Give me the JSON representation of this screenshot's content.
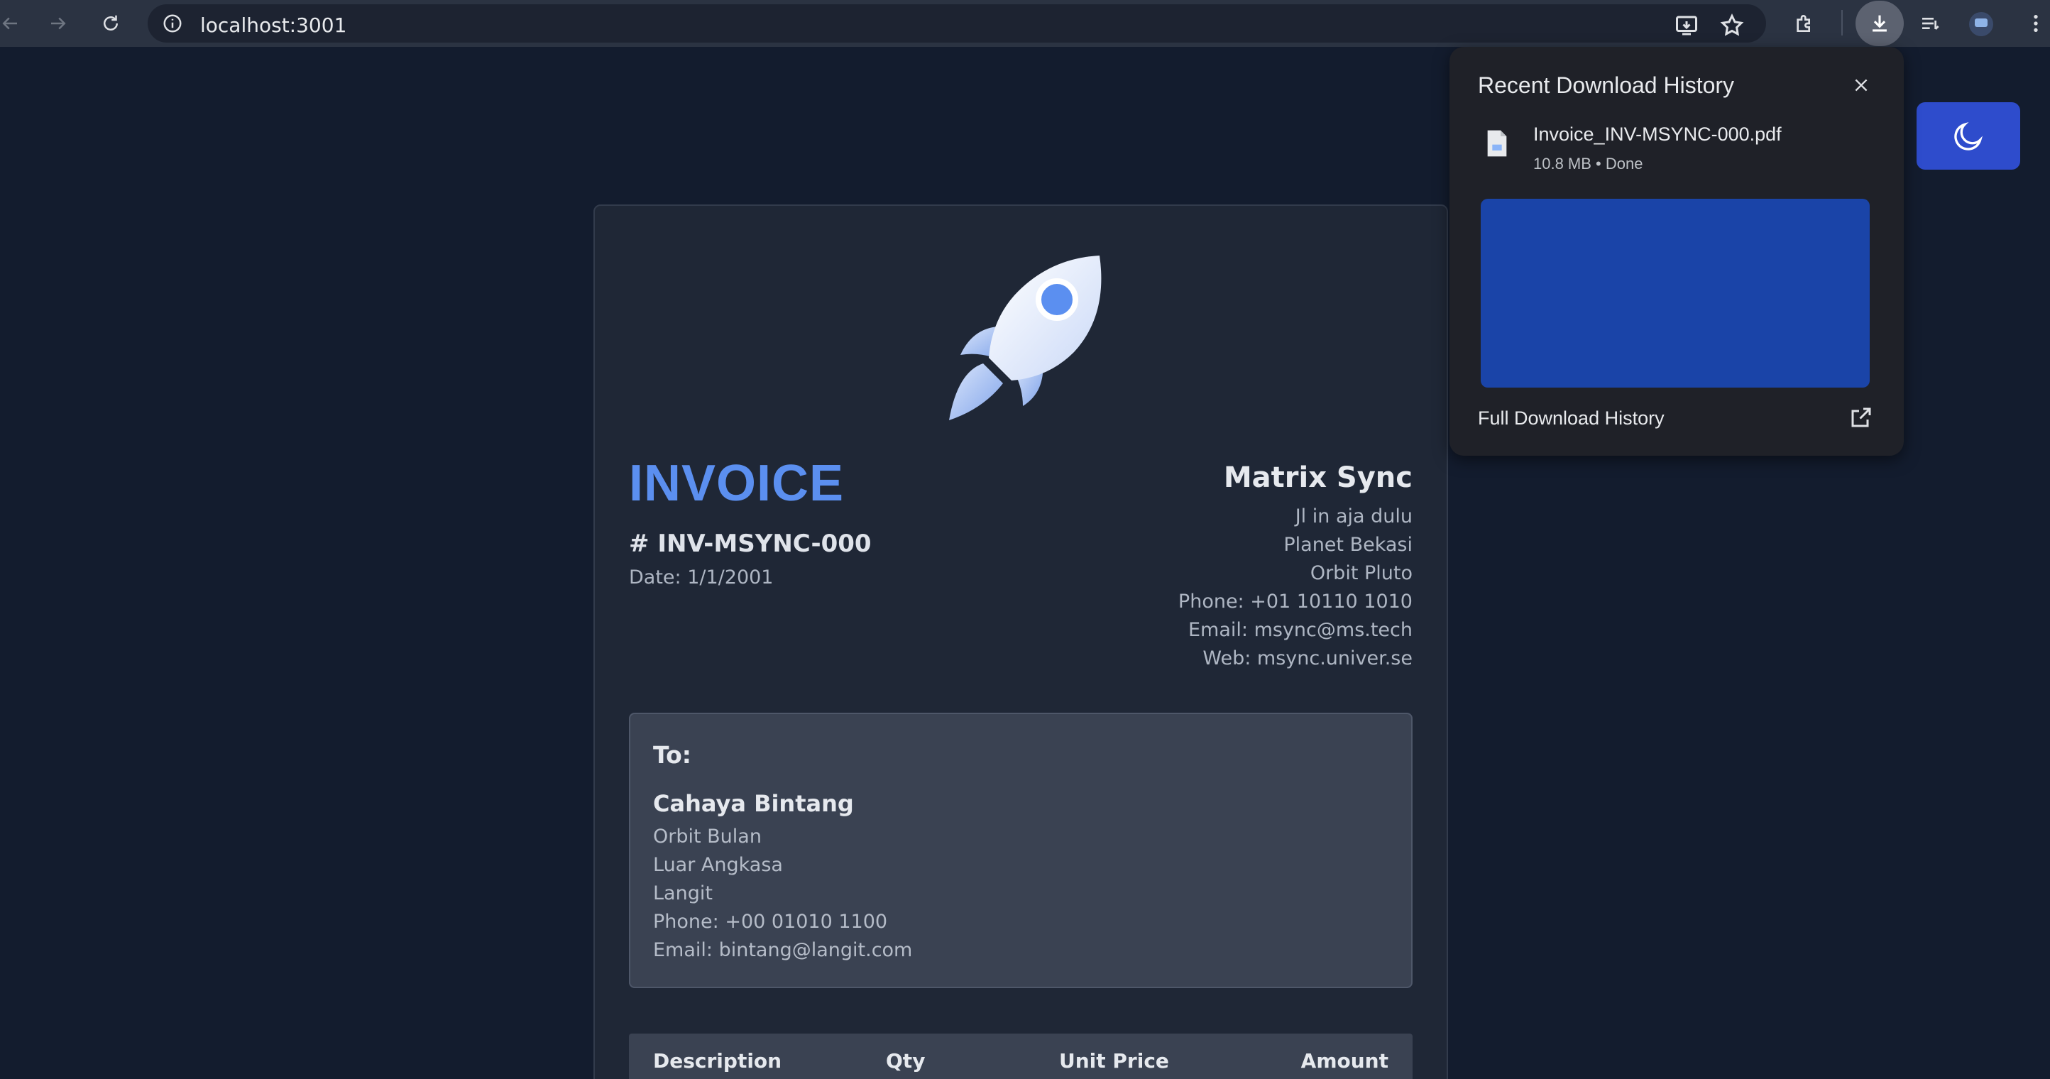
{
  "browser": {
    "url": "localhost:3001",
    "icons": [
      "back-icon",
      "forward-icon",
      "reload-icon",
      "info-icon",
      "install-app-icon",
      "bookmark-star-icon",
      "extensions-icon",
      "download-icon",
      "reading-list-icon",
      "profile-avatar",
      "menu-icon"
    ]
  },
  "downloads": {
    "title": "Recent Download History",
    "file_name": "Invoice_INV-MSYNC-000.pdf",
    "file_meta": "10.8 MB • Done",
    "full_history_label": "Full Download History",
    "thumbnail_color": "#1a44a8"
  },
  "theme_toggle": {
    "icon": "moon-icon",
    "color": "#2e4ccc"
  },
  "invoice": {
    "title": "INVOICE",
    "number": "# INV-MSYNC-000",
    "date": "Date: 1/1/2001",
    "company": {
      "name": "Matrix Sync",
      "lines": [
        "Jl in aja dulu",
        "Planet Bekasi",
        "Orbit Pluto",
        "Phone: +01 10110 1010",
        "Email: msync@ms.tech",
        "Web: msync.univer.se"
      ]
    },
    "to": {
      "label": "To:",
      "name": "Cahaya Bintang",
      "lines": [
        "Orbit Bulan",
        "Luar Angkasa",
        "Langit",
        "Phone: +00 01010 1100",
        "Email: bintang@langit.com"
      ]
    },
    "table": {
      "headers": [
        "Description",
        "Qty",
        "Unit Price",
        "Amount"
      ]
    },
    "accent_color": "#5b8ff0"
  }
}
